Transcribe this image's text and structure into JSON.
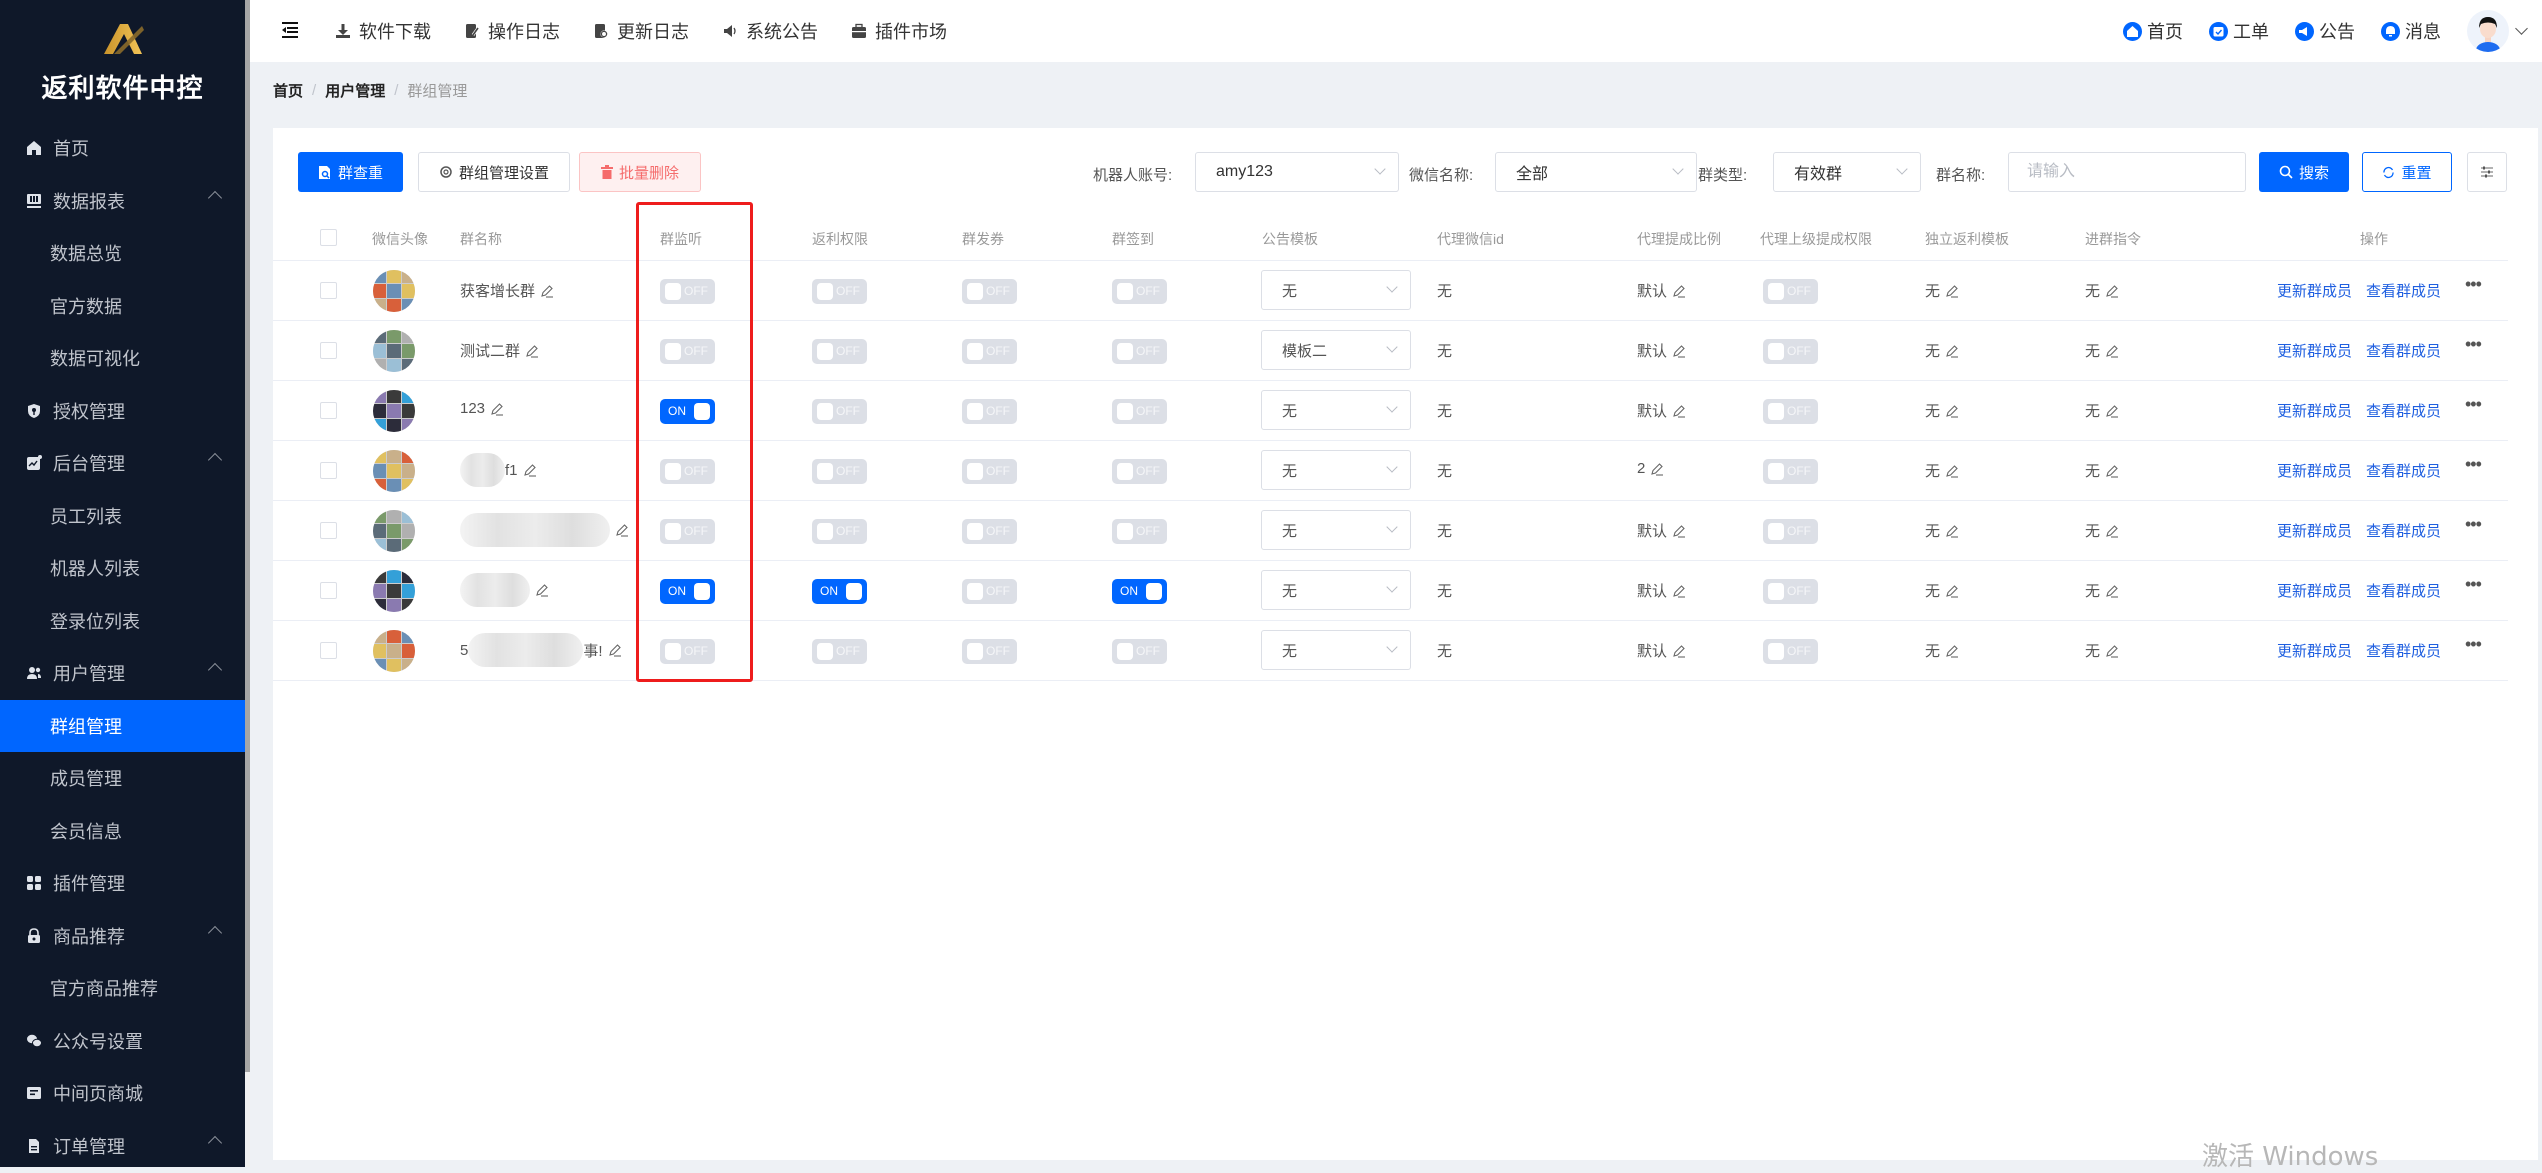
{
  "sidebar": {
    "brand": "返利软件中控",
    "items": [
      {
        "label": "首页",
        "icon": "home-icon",
        "type": "top"
      },
      {
        "label": "数据报表",
        "icon": "report-icon",
        "type": "group",
        "expanded": true
      },
      {
        "label": "数据总览",
        "type": "sub"
      },
      {
        "label": "官方数据",
        "type": "sub"
      },
      {
        "label": "数据可视化",
        "type": "sub"
      },
      {
        "label": "授权管理",
        "icon": "shield-icon",
        "type": "top"
      },
      {
        "label": "后台管理",
        "icon": "dashboard-icon",
        "type": "group",
        "expanded": true
      },
      {
        "label": "员工列表",
        "type": "sub"
      },
      {
        "label": "机器人列表",
        "type": "sub"
      },
      {
        "label": "登录位列表",
        "type": "sub"
      },
      {
        "label": "用户管理",
        "icon": "users-icon",
        "type": "group",
        "expanded": true
      },
      {
        "label": "群组管理",
        "type": "sub",
        "active": true
      },
      {
        "label": "成员管理",
        "type": "sub"
      },
      {
        "label": "会员信息",
        "type": "sub"
      },
      {
        "label": "插件管理",
        "icon": "grid-icon",
        "type": "top"
      },
      {
        "label": "商品推荐",
        "icon": "lock-icon",
        "type": "group",
        "expanded": true
      },
      {
        "label": "官方商品推荐",
        "type": "sub"
      },
      {
        "label": "公众号设置",
        "icon": "wechat-icon",
        "type": "top"
      },
      {
        "label": "中间页商城",
        "icon": "store-icon",
        "type": "top"
      },
      {
        "label": "订单管理",
        "icon": "file-icon",
        "type": "group",
        "expanded": true
      }
    ]
  },
  "header": {
    "nav": [
      {
        "label": "软件下载",
        "icon": "download-icon"
      },
      {
        "label": "操作日志",
        "icon": "edit-log-icon"
      },
      {
        "label": "更新日志",
        "icon": "update-log-icon"
      },
      {
        "label": "系统公告",
        "icon": "speaker-icon"
      },
      {
        "label": "插件市场",
        "icon": "briefcase-icon"
      }
    ],
    "right": [
      {
        "label": "首页",
        "icon": "home-icon"
      },
      {
        "label": "工单",
        "icon": "calendar-check-icon"
      },
      {
        "label": "公告",
        "icon": "megaphone-icon"
      },
      {
        "label": "消息",
        "icon": "bell-icon"
      }
    ]
  },
  "breadcrumb": [
    "首页",
    "用户管理",
    "群组管理"
  ],
  "toolbar": {
    "dup_check": "群查重",
    "settings": "群组管理设置",
    "batch_delete": "批量删除",
    "robot_label": "机器人账号:",
    "robot_value": "amy123",
    "wechat_label": "微信名称:",
    "wechat_value": "全部",
    "type_label": "群类型:",
    "type_value": "有效群",
    "name_label": "群名称:",
    "name_placeholder": "请输入",
    "search": "搜索",
    "reset": "重置"
  },
  "table": {
    "columns": [
      "微信头像",
      "群名称",
      "群监听",
      "返利权限",
      "群发券",
      "群签到",
      "公告模板",
      "代理微信id",
      "代理提成比例",
      "代理上级提成权限",
      "独立返利模板",
      "进群指令",
      "操作"
    ],
    "switch_on": "ON",
    "switch_off": "OFF",
    "action_update": "更新群成员",
    "action_view": "查看群成员",
    "more": "•••",
    "rows": [
      {
        "name": "获客增长群",
        "name_blurred": false,
        "listen": false,
        "rebate": false,
        "coupon": false,
        "signin": false,
        "template": "无",
        "agent_id": "无",
        "ratio": "默认",
        "upper": false,
        "rebate_tpl": "无",
        "join_cmd": "无"
      },
      {
        "name": "测试二群",
        "name_blurred": false,
        "listen": false,
        "rebate": false,
        "coupon": false,
        "signin": false,
        "template": "模板二",
        "agent_id": "无",
        "ratio": "默认",
        "upper": false,
        "rebate_tpl": "无",
        "join_cmd": "无"
      },
      {
        "name": "123",
        "name_blurred": false,
        "listen": true,
        "rebate": false,
        "coupon": false,
        "signin": false,
        "template": "无",
        "agent_id": "无",
        "ratio": "默认",
        "upper": false,
        "rebate_tpl": "无",
        "join_cmd": "无"
      },
      {
        "name": "群1",
        "name_blurred": true,
        "name_prefix": "",
        "name_suffix": "f1",
        "listen": false,
        "rebate": false,
        "coupon": false,
        "signin": false,
        "template": "无",
        "agent_id": "无",
        "ratio": "2",
        "upper": false,
        "rebate_tpl": "无",
        "join_cmd": "无"
      },
      {
        "name": "",
        "name_blurred": true,
        "name_prefix": "",
        "name_suffix": "",
        "listen": false,
        "rebate": false,
        "coupon": false,
        "signin": false,
        "template": "无",
        "agent_id": "无",
        "ratio": "默认",
        "upper": false,
        "rebate_tpl": "无",
        "join_cmd": "无"
      },
      {
        "name": "",
        "name_blurred": true,
        "name_prefix": "",
        "name_suffix": "",
        "listen": true,
        "rebate": true,
        "coupon": false,
        "signin": true,
        "template": "无",
        "agent_id": "无",
        "ratio": "默认",
        "upper": false,
        "rebate_tpl": "无",
        "join_cmd": "无"
      },
      {
        "name": "",
        "name_blurred": true,
        "name_prefix": "5",
        "name_suffix": "事!",
        "listen": false,
        "rebate": false,
        "coupon": false,
        "signin": false,
        "template": "无",
        "agent_id": "无",
        "ratio": "默认",
        "upper": false,
        "rebate_tpl": "无",
        "join_cmd": "无"
      }
    ]
  },
  "watermark": "激活 Windows",
  "colors": {
    "primary": "#0066ff",
    "sidebar_bg": "#0f1829",
    "danger": "#f56c6c",
    "highlight_box": "#ee1c1c"
  }
}
